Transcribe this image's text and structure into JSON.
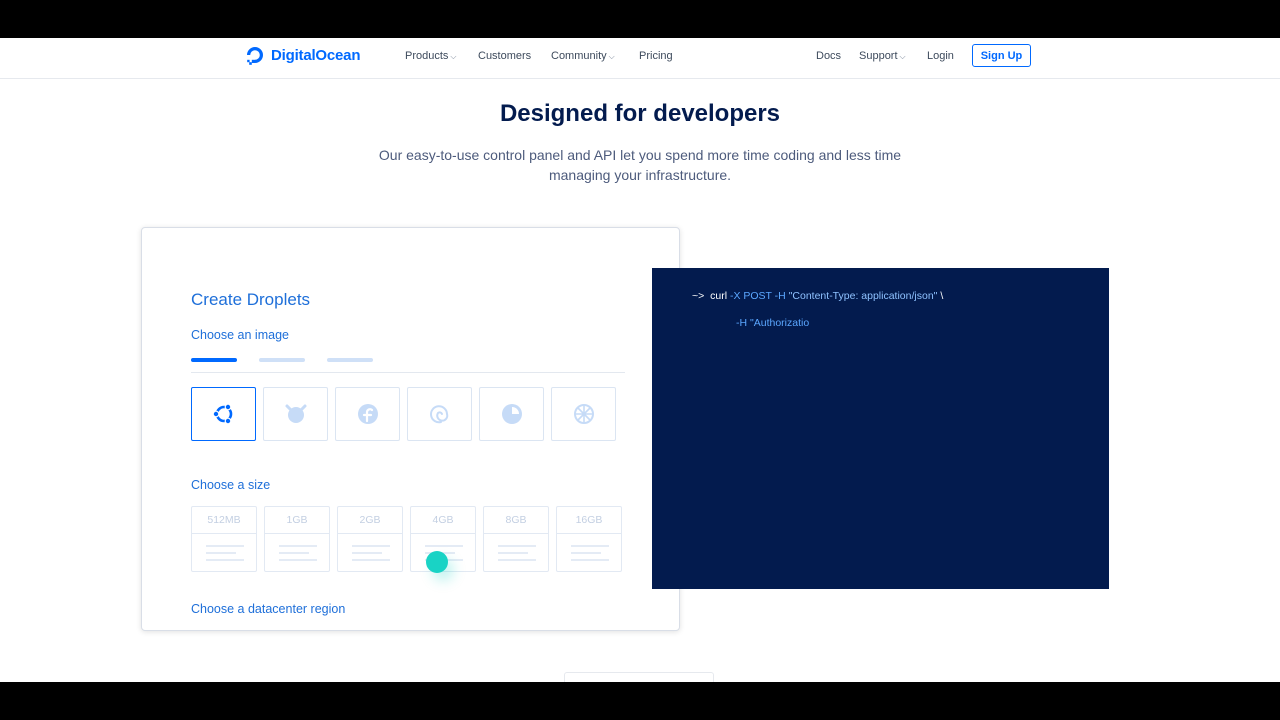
{
  "nav": {
    "brand": "DigitalOcean",
    "items": [
      {
        "label": "Products",
        "dropdown": true
      },
      {
        "label": "Customers",
        "dropdown": false
      },
      {
        "label": "Community",
        "dropdown": true
      },
      {
        "label": "Pricing",
        "dropdown": false
      }
    ],
    "right": [
      {
        "label": "Docs",
        "dropdown": false
      },
      {
        "label": "Support",
        "dropdown": true
      },
      {
        "label": "Login",
        "dropdown": false
      }
    ],
    "signup": "Sign Up",
    "chevron": "⌵"
  },
  "hero": {
    "title": "Designed for developers",
    "subtitle_line1": "Our easy-to-use control panel and API let you spend more time coding and less time",
    "subtitle_line2": "managing your infrastructure."
  },
  "card": {
    "title": "Create Droplets",
    "choose_image": "Choose an image",
    "choose_size": "Choose a size",
    "choose_region": "Choose a datacenter region",
    "images": [
      "ubuntu-icon",
      "freebsd-icon",
      "fedora-icon",
      "debian-icon",
      "centos-icon",
      "coreos-icon"
    ],
    "sizes": [
      "512MB",
      "1GB",
      "2GB",
      "4GB",
      "8GB",
      "16GB"
    ]
  },
  "terminal": {
    "prompt": "~>",
    "line1_cmd": "curl",
    "line1_flags": "-X POST -H",
    "line1_string": "\"Content-Type: application/json\"",
    "line1_end": "\\",
    "line2": "-H \"Authorizatio"
  },
  "colors": {
    "brand": "#0069ff",
    "terminal_bg": "#031b4e",
    "cursor": "#19d3c5"
  }
}
